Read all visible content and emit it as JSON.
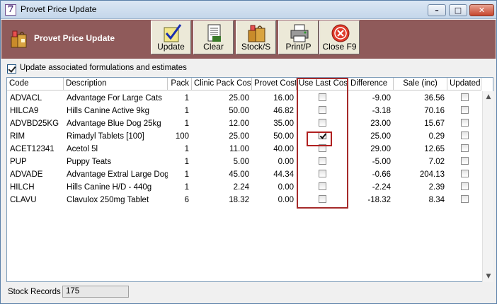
{
  "window": {
    "title": "Provet Price Update",
    "app_icon_glyph": "7",
    "min_glyph": "–",
    "max_glyph": "□",
    "close_glyph": "✕"
  },
  "header": {
    "title": "Provet Price Update",
    "background": "#8f5a5a",
    "buttons": [
      {
        "label": "Update",
        "icon": "update-check-icon"
      },
      {
        "label": "Clear",
        "icon": "clear-document-icon"
      },
      {
        "label": "Stock/S",
        "icon": "stock-bags-icon"
      },
      {
        "label": "Print/P",
        "icon": "printer-icon"
      },
      {
        "label": "Close F9",
        "icon": "close-circle-icon"
      }
    ]
  },
  "options": {
    "update_associated_label": "Update associated formulations and estimates",
    "update_associated_checked": true
  },
  "table": {
    "columns": [
      "Code",
      "Description",
      "Pack",
      "Clinic Pack Cost",
      "Provet Cost",
      "Use Last Cost",
      "Difference",
      "Sale (inc)",
      "Updated"
    ],
    "rows": [
      {
        "code": "ADVACL",
        "description": "Advantage For Large Cats",
        "pack": "1",
        "clinic_pack_cost": "25.00",
        "provet_cost": "16.00",
        "use_last_cost": false,
        "difference": "-9.00",
        "sale_inc": "36.56",
        "updated": false
      },
      {
        "code": "HILCA9",
        "description": "Hills Canine Active 9kg",
        "pack": "1",
        "clinic_pack_cost": "50.00",
        "provet_cost": "46.82",
        "use_last_cost": false,
        "difference": "-3.18",
        "sale_inc": "70.16",
        "updated": false
      },
      {
        "code": "ADVBD25KG",
        "description": "Advantage Blue Dog 25kg",
        "pack": "1",
        "clinic_pack_cost": "12.00",
        "provet_cost": "35.00",
        "use_last_cost": false,
        "difference": "23.00",
        "sale_inc": "15.67",
        "updated": false
      },
      {
        "code": "RIM",
        "description": "Rimadyl Tablets [100]",
        "pack": "100",
        "clinic_pack_cost": "25.00",
        "provet_cost": "50.00",
        "use_last_cost": true,
        "difference": "25.00",
        "sale_inc": "0.29",
        "updated": false
      },
      {
        "code": "ACET12341",
        "description": "Acetol 5l",
        "pack": "1",
        "clinic_pack_cost": "11.00",
        "provet_cost": "40.00",
        "use_last_cost": false,
        "difference": "29.00",
        "sale_inc": "12.65",
        "updated": false
      },
      {
        "code": "PUP",
        "description": "Puppy Teats",
        "pack": "1",
        "clinic_pack_cost": "5.00",
        "provet_cost": "0.00",
        "use_last_cost": false,
        "difference": "-5.00",
        "sale_inc": "7.02",
        "updated": false
      },
      {
        "code": "ADVADE",
        "description": "Advantage Extral Large Dog",
        "pack": "1",
        "clinic_pack_cost": "45.00",
        "provet_cost": "44.34",
        "use_last_cost": false,
        "difference": "-0.66",
        "sale_inc": "204.13",
        "updated": false
      },
      {
        "code": "HILCH",
        "description": "Hills Canine H/D - 440g",
        "pack": "1",
        "clinic_pack_cost": "2.24",
        "provet_cost": "0.00",
        "use_last_cost": false,
        "difference": "-2.24",
        "sale_inc": "2.39",
        "updated": false
      },
      {
        "code": "CLAVU",
        "description": "Clavulox 250mg Tablet",
        "pack": "6",
        "clinic_pack_cost": "18.32",
        "provet_cost": "0.00",
        "use_last_cost": false,
        "difference": "-18.32",
        "sale_inc": "8.34",
        "updated": false
      }
    ]
  },
  "status": {
    "label": "Stock Records",
    "value": "175"
  },
  "highlight_color": "#a52a2a"
}
